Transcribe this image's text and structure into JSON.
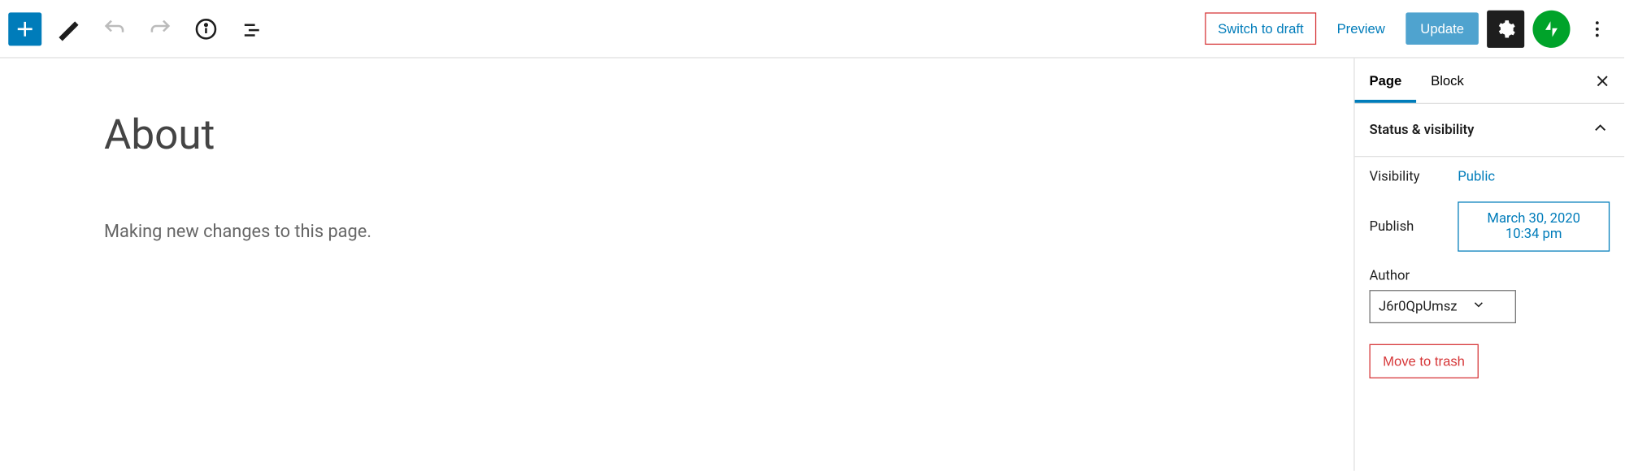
{
  "toolbar": {
    "switch_draft": "Switch to draft",
    "preview": "Preview",
    "update": "Update"
  },
  "editor": {
    "title": "About",
    "body": "Making new changes to this page."
  },
  "sidebar": {
    "tabs": {
      "page": "Page",
      "block": "Block"
    },
    "panel_title": "Status & visibility",
    "visibility_label": "Visibility",
    "visibility_value": "Public",
    "publish_label": "Publish",
    "publish_value": "March 30, 2020 10:34 pm",
    "author_label": "Author",
    "author_value": "J6r0QpUmsz",
    "trash": "Move to trash"
  }
}
